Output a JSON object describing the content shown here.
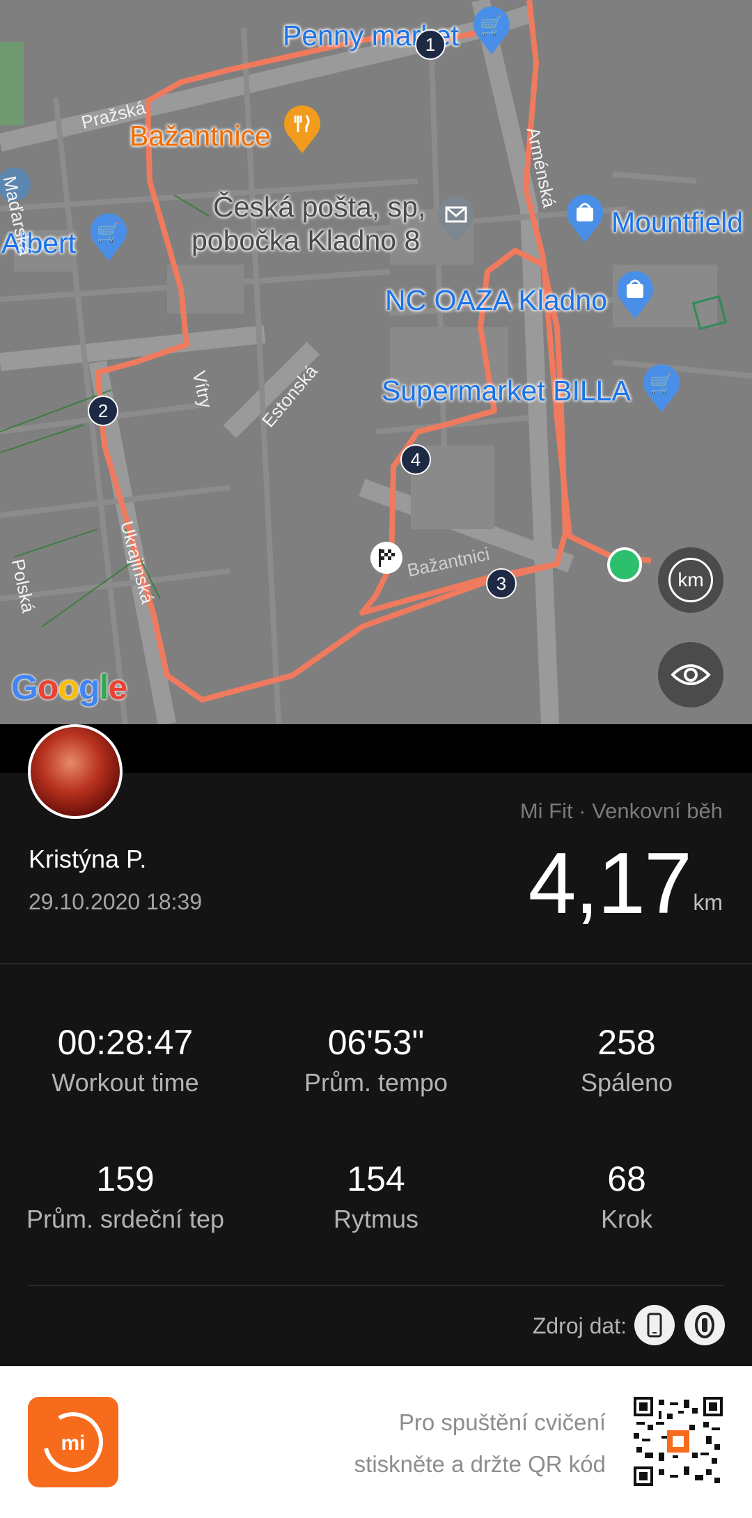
{
  "map": {
    "pois": [
      {
        "name": "Penny market",
        "color": "blue"
      },
      {
        "name": "Bažantnice",
        "color": "orange"
      },
      {
        "name": "Česká pošta, sp,",
        "color": "gray"
      },
      {
        "name": "pobočka Kladno 8",
        "color": "gray"
      },
      {
        "name": "Albert",
        "color": "blue"
      },
      {
        "name": "Mountfield",
        "color": "blue"
      },
      {
        "name": "NC OAZA Kladno",
        "color": "blue"
      },
      {
        "name": "Supermarket BILLA",
        "color": "blue"
      }
    ],
    "streets": [
      "Pražská",
      "Maďarská",
      "Arménská",
      "Vítry",
      "Estonská",
      "Ukrajinská",
      "Polská",
      "Bažantnici"
    ],
    "markers": [
      "1",
      "2",
      "3",
      "4"
    ],
    "google_logo": "Google",
    "km_button": "km",
    "route_color": "#f07a5e",
    "start_color": "#2bbf6e"
  },
  "profile": {
    "name": "Kristýna P.",
    "datetime": "29.10.2020 18:39",
    "source": "Mi Fit · Venkovní běh",
    "distance": "4,17",
    "unit": "km"
  },
  "stats": [
    {
      "value": "00:28:47",
      "label": "Workout time"
    },
    {
      "value": "06'53\"",
      "label": "Prům. tempo"
    },
    {
      "value": "258",
      "label": "Spáleno"
    },
    {
      "value": "159",
      "label": "Prům. srdeční tep"
    },
    {
      "value": "154",
      "label": "Rytmus"
    },
    {
      "value": "68",
      "label": "Krok"
    }
  ],
  "data_source_label": "Zdroj dat:",
  "footer": {
    "line1": "Pro spuštění cvičení",
    "line2": "stiskněte a držte QR kód",
    "accent": "#f76b1c"
  }
}
